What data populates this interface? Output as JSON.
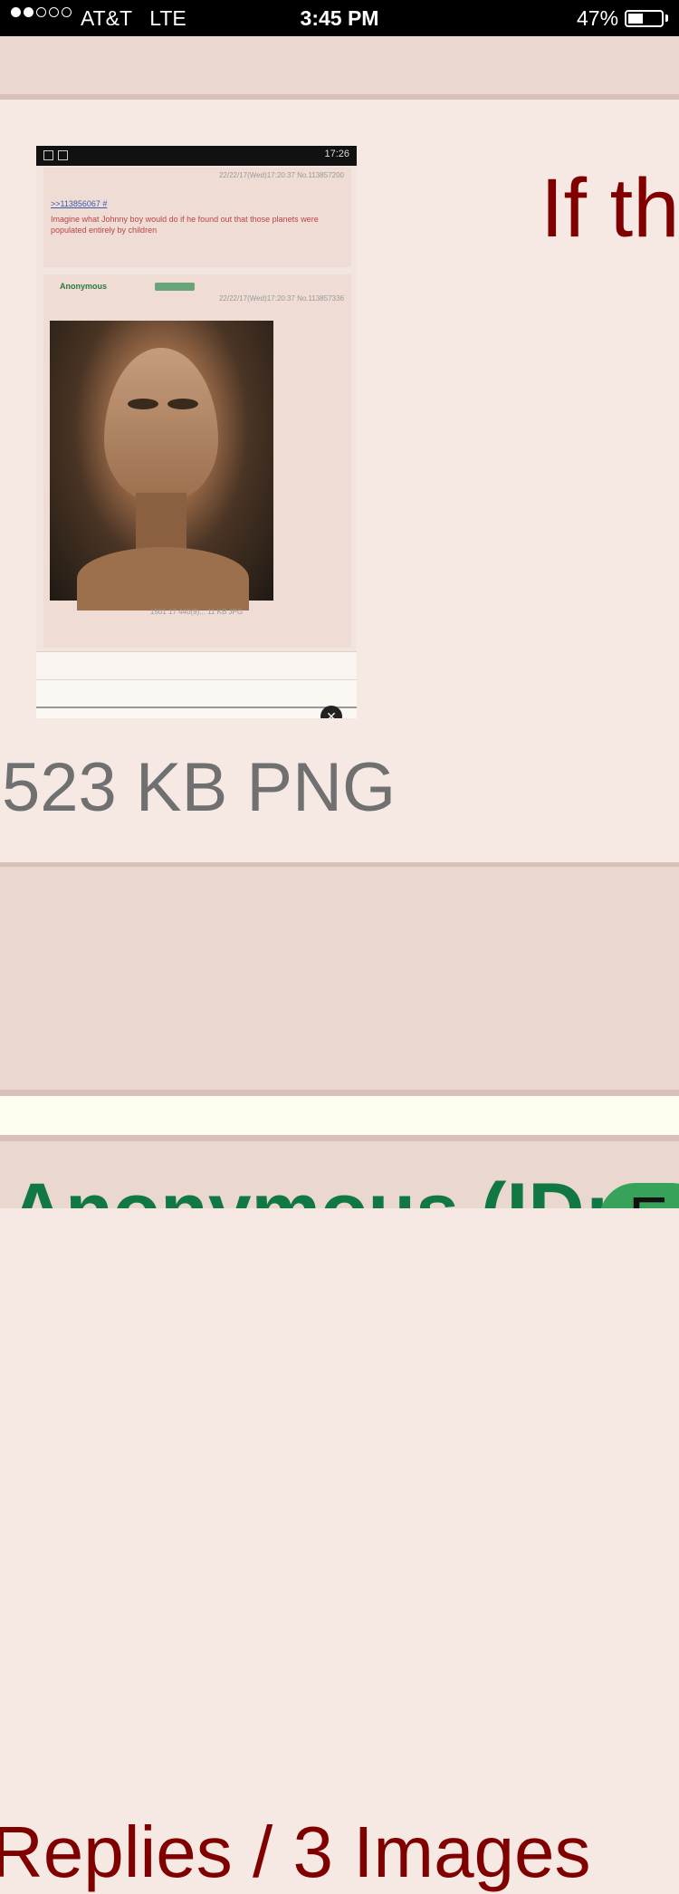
{
  "status_bar": {
    "carrier": "AT&T",
    "network": "LTE",
    "time": "3:45 PM",
    "battery": "47%",
    "battery_level": 0.47,
    "signal_bars": 2
  },
  "post": {
    "subject": "If th",
    "file_info": "523 KB PNG"
  },
  "thumbnail": {
    "time": "17:26",
    "post1_meta": "22/22/17(Wed)17:20:37 No.113857200",
    "post1_link": ">>113856067 #",
    "post1_text": "Imagine what Johnny boy would do if he found out that those planets were populated entirely by children",
    "post2_name": "Anonymous",
    "post2_meta": "22/22/17(Wed)17:20:37 No.113857336",
    "caption": "1501 17 440(9)... 11 KB JPG"
  },
  "thread": {
    "replies_text": "Replies / 3 Images"
  },
  "next_post": {
    "name": "Anonymous (ID:",
    "id_partial": "F"
  }
}
